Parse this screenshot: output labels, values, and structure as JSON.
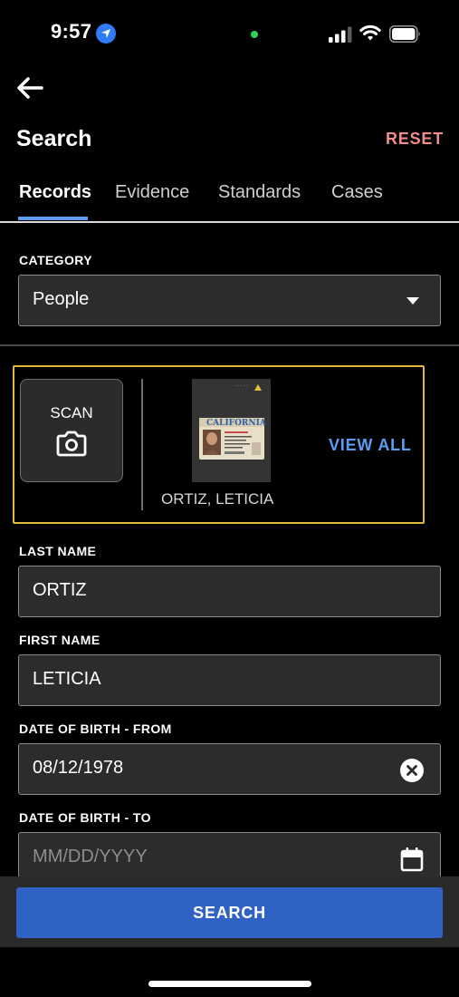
{
  "status_bar": {
    "time": "9:57"
  },
  "header": {
    "title": "Search",
    "reset_label": "RESET"
  },
  "tabs": [
    {
      "label": "Records",
      "active": true
    },
    {
      "label": "Evidence",
      "active": false
    },
    {
      "label": "Standards",
      "active": false
    },
    {
      "label": "Cases",
      "active": false
    }
  ],
  "category": {
    "label": "CATEGORY",
    "value": "People"
  },
  "scan": {
    "scan_label": "SCAN",
    "result_name": "ORTIZ, LETICIA",
    "view_all_label": "VIEW ALL",
    "license_state": "CALIFORNIA"
  },
  "fields": {
    "last_name": {
      "label": "LAST NAME",
      "value": "ORTIZ"
    },
    "first_name": {
      "label": "FIRST NAME",
      "value": "LETICIA"
    },
    "dob_from": {
      "label": "DATE OF BIRTH - FROM",
      "value": "08/12/1978"
    },
    "dob_to": {
      "label": "DATE OF BIRTH - TO",
      "placeholder": "MM/DD/YYYY"
    }
  },
  "search_button": {
    "label": "SEARCH"
  },
  "colors": {
    "accent_blue": "#5b9df5",
    "reset_red": "#f08c8c",
    "scan_border": "#e1b73b",
    "search_blue": "#2f62c4"
  }
}
